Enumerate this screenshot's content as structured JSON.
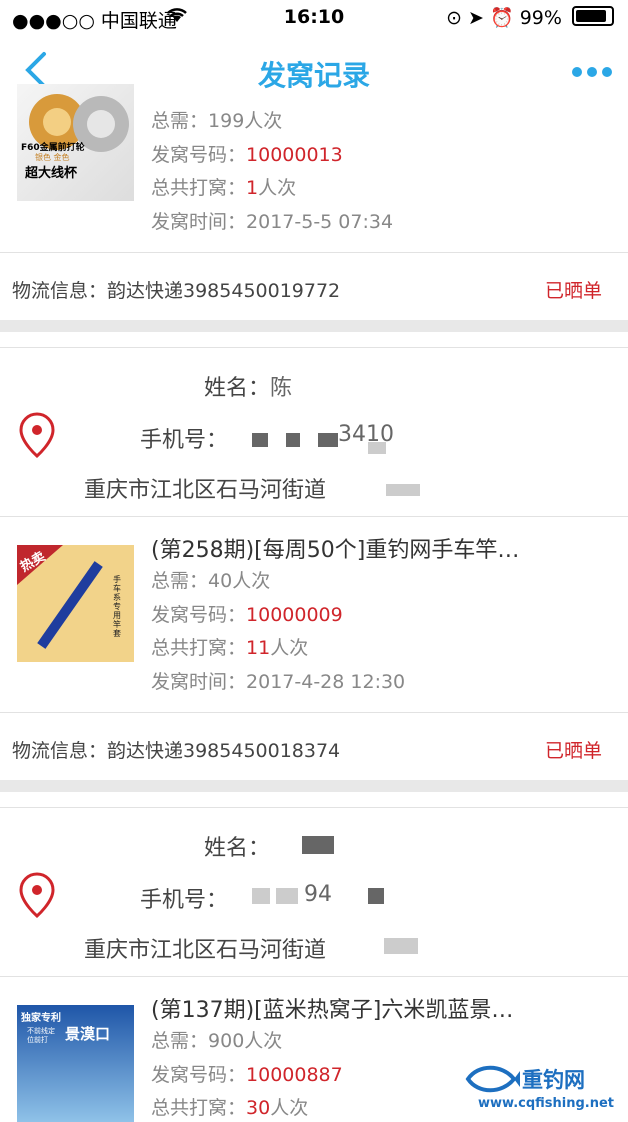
{
  "status_bar": {
    "carrier": "●●●○○ 中国联通",
    "time": "16:10",
    "battery": "99%"
  },
  "nav": {
    "title": "发窝记录"
  },
  "orders": [
    {
      "title": "",
      "total_label": "总需：",
      "total": "199人次",
      "number_label": "发窝号码：",
      "number": "10000013",
      "bets_label": "总共打窝：",
      "bets_num": "1",
      "bets_unit": "人次",
      "time_label": "发窝时间：",
      "time": "2017-5-5 07:34",
      "image_text": [
        "F60金属前打轮",
        "银色 金色",
        "超大线杯"
      ],
      "logistics": "物流信息：韵达快递3985450019772",
      "status": "已晒单"
    },
    {
      "title": "(第258期)[每周50个]重钓网手车竿…",
      "total_label": "总需：",
      "total": "40人次",
      "number_label": "发窝号码：",
      "number": "10000009",
      "bets_label": "总共打窝：",
      "bets_num": "11",
      "bets_unit": "人次",
      "time_label": "发窝时间：",
      "time": "2017-4-28 12:30",
      "image_text": [
        "热卖",
        "手车系专用竿套"
      ],
      "logistics": "物流信息：韵达快递3985450018374",
      "status": "已晒单"
    },
    {
      "title": "(第137期)[蓝米热窝子]六米凯蓝景…",
      "total_label": "总需：",
      "total": "900人次",
      "number_label": "发窝号码：",
      "number": "10000887",
      "bets_label": "总共打窝：",
      "bets_num": "30",
      "bets_unit": "人次",
      "image_text": [
        "独家专利",
        "不前线定位前打",
        "景漠口"
      ]
    }
  ],
  "addresses": [
    {
      "name_label": "姓名：",
      "name": "陈",
      "phone_label": "手机号：",
      "phone": "3410",
      "address": "重庆市江北区石马河街道"
    },
    {
      "name_label": "姓名：",
      "name": "",
      "phone_label": "手机号：",
      "phone": "94",
      "address": "重庆市江北区石马河街道"
    }
  ],
  "watermark": {
    "brand": "重钓网",
    "url": "www.cqfishing.net"
  },
  "colors": {
    "accent": "#2ba7e6",
    "red": "#d0252b"
  }
}
